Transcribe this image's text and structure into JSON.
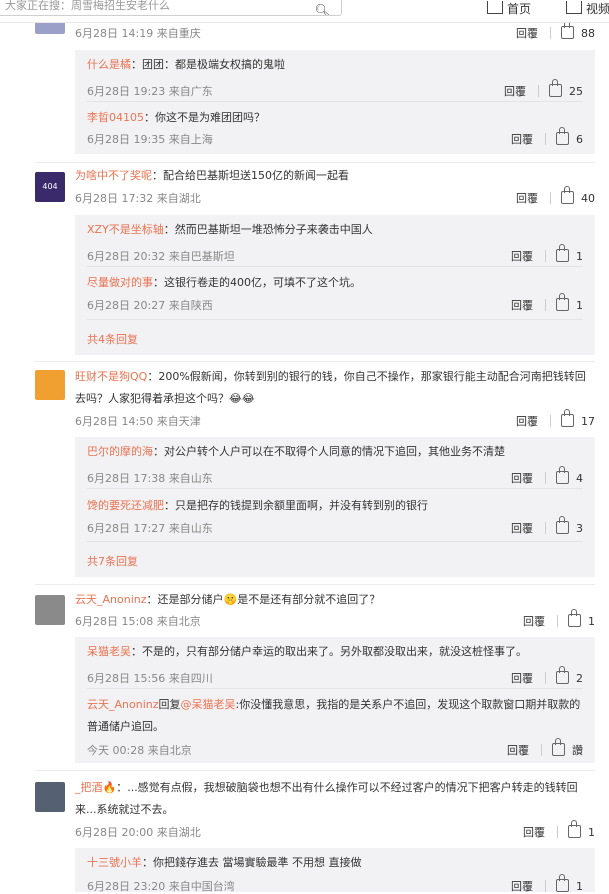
{
  "topbar": {
    "search_placeholder": "大家正在搜：周雪梅招生安老什么",
    "home_label": "首页",
    "video_label": "视频"
  },
  "labels": {
    "reply": "回覆",
    "reply_verb": "回复"
  },
  "comments": [
    {
      "avatar_color": "#9aa0c8",
      "user": "",
      "text": "",
      "meta": "6月28日 14:19 来自重庆",
      "likes": "88",
      "replies": [
        {
          "user": "什么是橘",
          "text": "：团团：都是极端女权搞的鬼啦",
          "meta": "6月28日 19:23 来自广东",
          "likes": "25"
        },
        {
          "user": "李晢04105",
          "text": "：你这不是为难团团吗？",
          "meta": "6月28日 19:35 来自上海",
          "likes": "6"
        }
      ]
    },
    {
      "avatar_color": "#3b2a6b",
      "avatar_text": "404",
      "user": "为啥中不了奖呢",
      "text": "：配合给巴基斯坦送150亿的新闻一起看",
      "meta": "6月28日 17:32 来自湖北",
      "likes": "40",
      "replies": [
        {
          "user": "XZY不是坐标轴",
          "text": "：然而巴基斯坦一堆恐怖分子来袭击中国人",
          "meta": "6月28日 20:32 来自巴基斯坦",
          "likes": "1"
        },
        {
          "user": "尽量做对的事",
          "text": "：这银行卷走的400亿，可填不了这个坑。",
          "meta": "6月28日 20:27 来自陕西",
          "likes": "1"
        }
      ],
      "more": "共4条回复"
    },
    {
      "avatar_color": "#f0a030",
      "user": "旺财不是狗QQ",
      "text": "：200%假新闻，你转到别的银行的钱，你自己不操作，那家银行能主动配合河南把钱转回去吗？人家犯得着承担这个吗？😂😂",
      "meta": "6月28日 14:50 来自天津",
      "likes": "17",
      "replies": [
        {
          "user": "巴尔的摩的海",
          "text": "：对公户转个人户可以在不取得个人同意的情况下追回，其他业务不清楚",
          "meta": "6月28日 17:38 来自山东",
          "likes": "4"
        },
        {
          "user": "馋的要死还减肥",
          "text": "：只是把存的钱提到余额里面啊，并没有转到别的银行",
          "meta": "6月28日 17:27 来自山东",
          "likes": "3"
        }
      ],
      "more": "共7条回复"
    },
    {
      "avatar_color": "#8a8a8a",
      "user": "云天_Anoninz",
      "text": "：还是部分储户🤫是不是还有部分就不追回了？",
      "meta": "6月28日 15:08 来自北京",
      "likes": "1",
      "replies": [
        {
          "user": "呆猫老吴",
          "text": "：不是的，只有部分储户幸运的取出来了。另外取都没取出来，就没这桩怪事了。",
          "meta": "6月28日 15:56 来自四川",
          "likes": "2"
        },
        {
          "user": "云天_Anoninz",
          "reply_to": "@呆猫老吴",
          "text": ":你没懂我意思，我指的是关系户不追回，发现这个取款窗口期并取款的普通储户追回。",
          "meta": "今天 00:28 来自北京",
          "likes": "讚"
        }
      ]
    },
    {
      "avatar_color": "#556070",
      "user": "_把酒",
      "text": "🔥：...感觉有点假，我想破脑袋也想不出有什么操作可以不经过客户的情况下把客户转走的钱转回来...系统就过不去。",
      "meta": "6月28日 20:00 来自湖北",
      "likes": "1",
      "replies": [
        {
          "user": "十三號小羊",
          "text": "：你把錢存進去 當場實驗最準 不用想 直接做",
          "meta": "6月28日 23:20 来自中国台湾",
          "likes": "1"
        }
      ]
    }
  ]
}
